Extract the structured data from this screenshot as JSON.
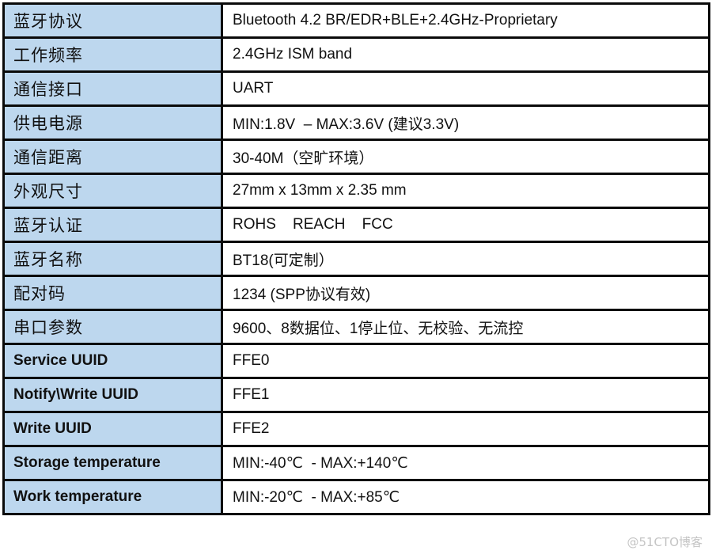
{
  "table": {
    "rows": [
      {
        "key": "蓝牙协议",
        "value": "Bluetooth 4.2 BR/EDR+BLE+2.4GHz-Proprietary"
      },
      {
        "key": "工作频率",
        "value": "2.4GHz ISM band"
      },
      {
        "key": "通信接口",
        "value": "UART"
      },
      {
        "key": "供电电源",
        "value": "MIN:1.8V  – MAX:3.6V (建议3.3V)"
      },
      {
        "key": "通信距离",
        "value": "30-40M（空旷环境）"
      },
      {
        "key": "外观尺寸",
        "value": "27mm x 13mm x 2.35 mm"
      },
      {
        "key": "蓝牙认证",
        "value": "ROHS    REACH    FCC"
      },
      {
        "key": "蓝牙名称",
        "value": "BT18(可定制）"
      },
      {
        "key": "配对码",
        "value": "1234 (SPP协议有效)"
      },
      {
        "key": "串口参数",
        "value": "9600、8数据位、1停止位、无校验、无流控"
      },
      {
        "key": "Service UUID",
        "value": "FFE0"
      },
      {
        "key": "Notify\\Write UUID",
        "value": "FFE1"
      },
      {
        "key": "Write UUID",
        "value": "FFE2"
      },
      {
        "key": "Storage temperature",
        "value": "MIN:-40℃  - MAX:+140℃"
      },
      {
        "key": "Work temperature",
        "value": "MIN:-20℃  - MAX:+85℃"
      }
    ]
  },
  "colors": {
    "key_column_bg": "#bdd7ee",
    "border": "#0a0a0a",
    "text": "#111111"
  },
  "watermark": "@51CTO博客"
}
